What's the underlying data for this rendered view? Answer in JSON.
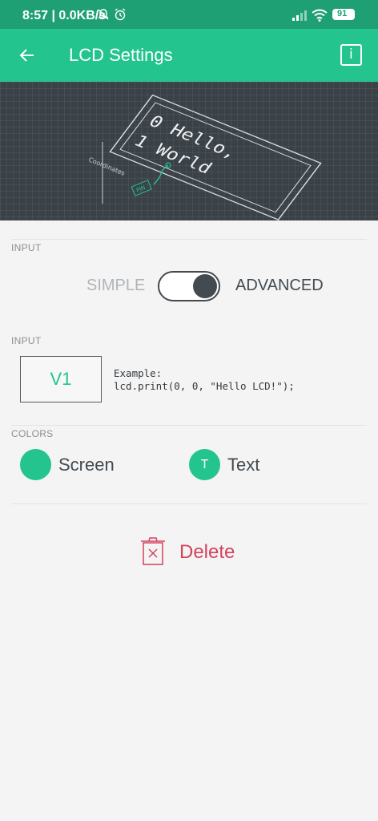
{
  "status_bar": {
    "time": "8:57",
    "network_speed": "0.0KB/s",
    "battery": "91",
    "icons": [
      "bell-off-icon",
      "alarm-icon",
      "signal-icon",
      "wifi-icon",
      "battery-icon"
    ]
  },
  "app_bar": {
    "back_icon": "arrow-left-icon",
    "title": "LCD Settings",
    "info_icon": "info-icon",
    "info_glyph": "i"
  },
  "hero": {
    "line1": "0 Hello,",
    "line2": "1 World",
    "coordinates_label": "Coordinates",
    "pin_label": "PIN"
  },
  "input_mode": {
    "label": "INPUT",
    "simple_label": "SIMPLE",
    "advanced_label": "ADVANCED",
    "advanced_enabled": true
  },
  "pin_input": {
    "label": "INPUT",
    "pin_value": "V1",
    "example": "Example:\nlcd.print(0, 0, \"Hello LCD!\");"
  },
  "colors": {
    "label": "COLORS",
    "screen_label": "Screen",
    "text_label": "Text",
    "text_swatch_glyph": "T",
    "screen_color": "#23c48e",
    "text_color": "#23c48e"
  },
  "delete": {
    "label": "Delete",
    "icon": "trash-icon",
    "color": "#d3435c"
  },
  "theme": {
    "accent": "#23c48e",
    "status_bar": "#1ea074",
    "hero_bg": "#3a4147"
  }
}
